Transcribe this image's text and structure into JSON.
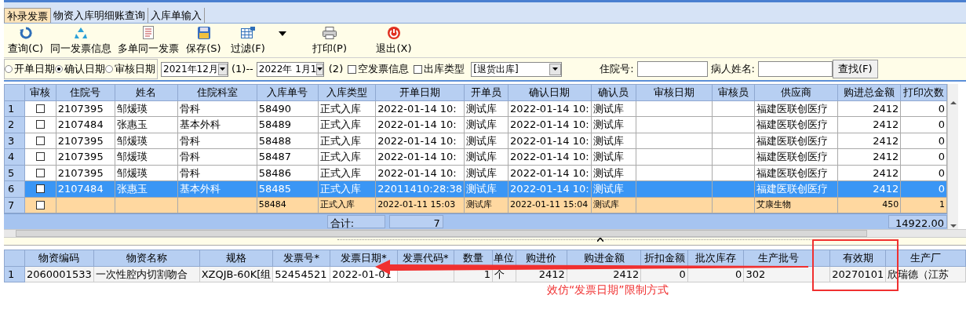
{
  "tabs": [
    {
      "label": "补录发票",
      "selected": true
    },
    {
      "label": "物资入库明细账查询",
      "selected": false
    },
    {
      "label": "入库单输入",
      "selected": false
    }
  ],
  "toolbar": [
    {
      "label": "查询(C)",
      "dropdown": false
    },
    {
      "label": "同一发票信息",
      "dropdown": false
    },
    {
      "label": "多单同一发票",
      "dropdown": false
    },
    {
      "label": "保存(S)",
      "dropdown": false
    },
    {
      "label": "过滤(F)",
      "dropdown": true
    },
    {
      "label": "打印(P)",
      "dropdown": false
    },
    {
      "label": "退出(X)",
      "dropdown": false
    }
  ],
  "filter": {
    "date_types": [
      {
        "label": "开单日期",
        "selected": false
      },
      {
        "label": "确认日期",
        "selected": true
      },
      {
        "label": "审核日期",
        "selected": false
      }
    ],
    "from_date": "2021年12月",
    "from_label": "(1)--",
    "to_date": "2022年 1月1",
    "to_label": "(2)",
    "checkboxes": [
      {
        "label": "空发票信息",
        "checked": false
      },
      {
        "label": "出库类型",
        "checked": false
      }
    ],
    "out_type": "[退货出库]",
    "inpatient_label": "住院号:",
    "patient_label": "病人姓名:",
    "find_button": "查找(F)"
  },
  "main_table": {
    "check_column": "审核",
    "columns": [
      "住院号",
      "姓名",
      "住院科室",
      "入库单号",
      "入库类型",
      "开单日期",
      "开单员",
      "确认日期",
      "确认员",
      "审核日期",
      "审核员",
      "供应商",
      "购进总金额",
      "打印次数"
    ],
    "rows": [
      {
        "number": "1",
        "selected": false,
        "highlighted": false,
        "checked": false,
        "cells": [
          "2107395",
          "邹煖瑛",
          "骨科",
          "58490",
          "正式入库",
          "2022-01-14 10:",
          "测试库",
          "2022-01-14 10:",
          "测试库",
          null,
          null,
          "福建医联创医疗",
          "2412",
          "0"
        ]
      },
      {
        "number": "2",
        "selected": false,
        "highlighted": false,
        "checked": false,
        "cells": [
          "2107484",
          "张惠玉",
          "基本外科",
          "58489",
          "正式入库",
          "2022-01-14 10:",
          "测试库",
          "2022-01-14 10:",
          "测试库",
          null,
          null,
          "福建医联创医疗",
          "2412",
          "0"
        ]
      },
      {
        "number": "3",
        "selected": false,
        "highlighted": false,
        "checked": false,
        "cells": [
          "2107395",
          "邹煖瑛",
          "骨科",
          "58488",
          "正式入库",
          "2022-01-14 10:",
          "测试库",
          "2022-01-14 10:",
          "测试库",
          null,
          null,
          "福建医联创医疗",
          "2412",
          "0"
        ]
      },
      {
        "number": "4",
        "selected": false,
        "highlighted": false,
        "checked": false,
        "cells": [
          "2107395",
          "邹煖瑛",
          "骨科",
          "58487",
          "正式入库",
          "2022-01-14 10:",
          "测试库",
          "2022-01-14 10:",
          "测试库",
          null,
          null,
          "福建医联创医疗",
          "2412",
          "0"
        ]
      },
      {
        "number": "5",
        "selected": false,
        "highlighted": false,
        "checked": false,
        "cells": [
          "2107395",
          "邹煖瑛",
          "骨科",
          "58486",
          "正式入库",
          "2022-01-14 10:",
          "测试库",
          "2022-01-14 10:",
          "测试库",
          null,
          null,
          "福建医联创医疗",
          "2412",
          "0"
        ]
      },
      {
        "number": "6",
        "selected": true,
        "highlighted": false,
        "checked": false,
        "cells": [
          "2107484",
          "张惠玉",
          "基本外科",
          "58485",
          "正式入库",
          "22011410:28:38",
          "测试库",
          "2022-01-14 10:",
          "测试库",
          null,
          null,
          "福建医联创医疗",
          "2412",
          "0"
        ]
      },
      {
        "number": "7",
        "selected": false,
        "highlighted": true,
        "checked": false,
        "cells": [
          null,
          null,
          null,
          "58484",
          "正式入库",
          "2022-01-11 15:03",
          "测试库",
          "2022-01-11 15:04",
          "测试库",
          null,
          null,
          "艾康生物",
          "450",
          "1"
        ]
      }
    ],
    "totals": {
      "label": "合计:",
      "count": "7",
      "amount": "14922.00"
    }
  },
  "detail_table": {
    "columns": [
      "物资编码",
      "物资名称",
      "规格",
      "发票号*",
      "发票日期*",
      "发票代码*",
      "数量",
      "单位",
      "购进价",
      "购进金额",
      "折扣金额",
      "批次库存",
      "生产批号",
      null,
      "有效期",
      "生产厂"
    ],
    "rows": [
      {
        "number": "1",
        "cells": [
          "2060001533",
          "一次性腔内切割吻合",
          "XZQJB-60K[组",
          "52454521",
          "2022-01-01",
          null,
          "1",
          "个",
          "2412",
          "2412",
          "0",
          "0",
          "302",
          null,
          "20270101",
          "欣瑞德（江苏"
        ]
      }
    ]
  },
  "annotation": {
    "text": "效仿“发票日期”限制方式"
  }
}
